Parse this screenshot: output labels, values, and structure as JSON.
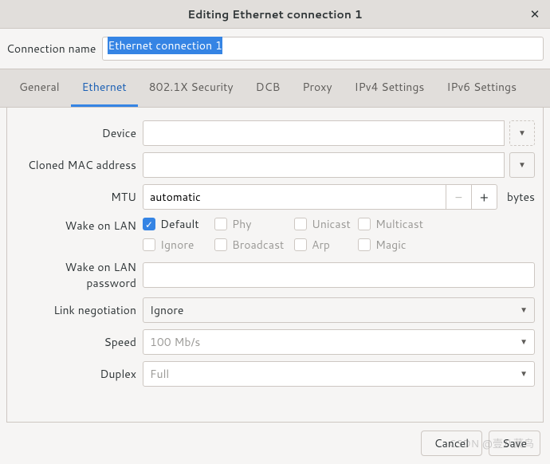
{
  "title": "Editing Ethernet connection 1",
  "connection_name_label": "Connection name",
  "connection_name_value": "Ethernet connection 1",
  "tabs": {
    "general": "General",
    "ethernet": "Ethernet",
    "security": "802.1X Security",
    "dcb": "DCB",
    "proxy": "Proxy",
    "ipv4": "IPv4 Settings",
    "ipv6": "IPv6 Settings"
  },
  "labels": {
    "device": "Device",
    "cloned_mac": "Cloned MAC address",
    "mtu": "MTU",
    "wol": "Wake on LAN",
    "wol_pw": "Wake on LAN password",
    "link_neg": "Link negotiation",
    "speed": "Speed",
    "duplex": "Duplex",
    "bytes": "bytes"
  },
  "values": {
    "device": "",
    "cloned_mac": "",
    "mtu": "automatic",
    "wol_pw": "",
    "link_neg": "Ignore",
    "speed": "100 Mb/s",
    "duplex": "Full"
  },
  "wol_checks": {
    "default": "Default",
    "phy": "Phy",
    "unicast": "Unicast",
    "multicast": "Multicast",
    "ignore": "Ignore",
    "broadcast": "Broadcast",
    "arp": "Arp",
    "magic": "Magic"
  },
  "buttons": {
    "cancel": "Cancel",
    "save": "Save"
  },
  "watermark": "CSDN @壹八菜鸟"
}
